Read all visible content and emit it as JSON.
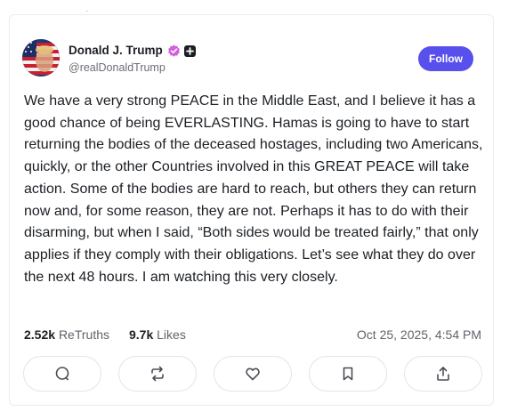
{
  "post": {
    "author": {
      "display_name": "Donald J. Trump",
      "handle": "@realDonaldTrump",
      "verified": true,
      "avatar_icon": "avatar-flag-portrait"
    },
    "follow_label": "Follow",
    "body": "We have a very strong PEACE in the Middle East, and I believe it has a good chance of being EVERLASTING. Hamas is going to have to start returning the bodies of the deceased hostages, including two Americans, quickly, or the other Countries involved in this GREAT PEACE will take action. Some of the bodies are hard to reach, but others they can return now and, for some reason, they are not. Perhaps it has to do with their disarming, but when I said, “Both sides would be treated fairly,” that only applies if they comply with their obligations. Let’s see what they do over the next 48 hours. I am watching this very closely.",
    "stats": {
      "retruths_count": "2.52k",
      "retruths_label": "ReTruths",
      "likes_count": "9.7k",
      "likes_label": "Likes"
    },
    "timestamp": "Oct 25, 2025, 4:54 PM"
  },
  "actions": [
    {
      "name": "reply",
      "icon": "comment-icon"
    },
    {
      "name": "retruth",
      "icon": "repost-icon"
    },
    {
      "name": "like",
      "icon": "heart-icon"
    },
    {
      "name": "bookmark",
      "icon": "bookmark-icon"
    },
    {
      "name": "share",
      "icon": "share-icon"
    }
  ],
  "colors": {
    "accent": "#5850ec",
    "verified_badge": "#d35fd9",
    "text_primary": "#1b1f24",
    "text_secondary": "#5f636a",
    "border": "#e3e4e8"
  }
}
